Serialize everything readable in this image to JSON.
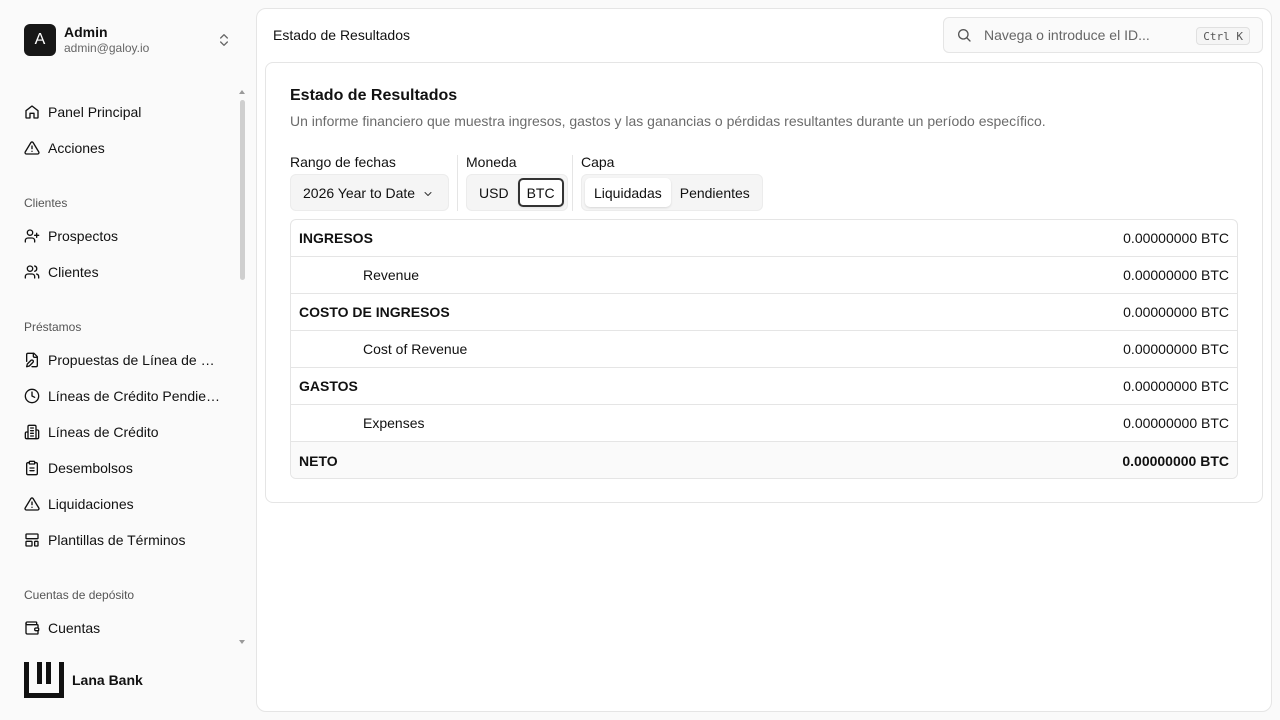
{
  "user": {
    "initial": "A",
    "name": "Admin",
    "email": "admin@galoy.io"
  },
  "nav": {
    "main": [
      {
        "label": "Panel Principal",
        "icon": "home-icon"
      },
      {
        "label": "Acciones",
        "icon": "alert-triangle-icon"
      }
    ],
    "groups": [
      {
        "label": "Clientes",
        "items": [
          {
            "label": "Prospectos",
            "icon": "user-plus-icon"
          },
          {
            "label": "Clientes",
            "icon": "users-icon"
          }
        ]
      },
      {
        "label": "Préstamos",
        "items": [
          {
            "label": "Propuestas de Línea de Crédito",
            "icon": "file-edit-icon"
          },
          {
            "label": "Líneas de Crédito Pendientes",
            "icon": "clock-icon"
          },
          {
            "label": "Líneas de Crédito",
            "icon": "building-icon"
          },
          {
            "label": "Desembolsos",
            "icon": "clipboard-icon"
          },
          {
            "label": "Liquidaciones",
            "icon": "alert-triangle-icon"
          },
          {
            "label": "Plantillas de Términos",
            "icon": "layout-template-icon"
          }
        ]
      },
      {
        "label": "Cuentas de depósito",
        "items": [
          {
            "label": "Cuentas",
            "icon": "wallet-icon"
          }
        ]
      }
    ]
  },
  "brand": {
    "name": "Lana Bank"
  },
  "header": {
    "title": "Estado de Resultados",
    "search_placeholder": "Navega o introduce el ID...",
    "search_shortcut": "Ctrl K"
  },
  "report": {
    "title": "Estado de Resultados",
    "description": "Un informe financiero que muestra ingresos, gastos y las ganancias o pérdidas resultantes durante un período específico.",
    "filters": {
      "date_range_label": "Rango de fechas",
      "date_range_value": "2026 Year to Date",
      "currency_label": "Moneda",
      "currency_options": [
        "USD",
        "BTC"
      ],
      "currency_selected": "BTC",
      "layer_label": "Capa",
      "layer_options": [
        "Liquidadas",
        "Pendientes"
      ],
      "layer_selected": "Liquidadas"
    },
    "rows": [
      {
        "name": "INGRESOS",
        "amount": "0.00000000 BTC",
        "kind": "head"
      },
      {
        "name": "Revenue",
        "amount": "0.00000000 BTC",
        "kind": "sub"
      },
      {
        "name": "COSTO DE INGRESOS",
        "amount": "0.00000000 BTC",
        "kind": "head"
      },
      {
        "name": "Cost of Revenue",
        "amount": "0.00000000 BTC",
        "kind": "sub"
      },
      {
        "name": "GASTOS",
        "amount": "0.00000000 BTC",
        "kind": "head"
      },
      {
        "name": "Expenses",
        "amount": "0.00000000 BTC",
        "kind": "sub"
      },
      {
        "name": "NETO",
        "amount": "0.00000000 BTC",
        "kind": "total"
      }
    ]
  }
}
